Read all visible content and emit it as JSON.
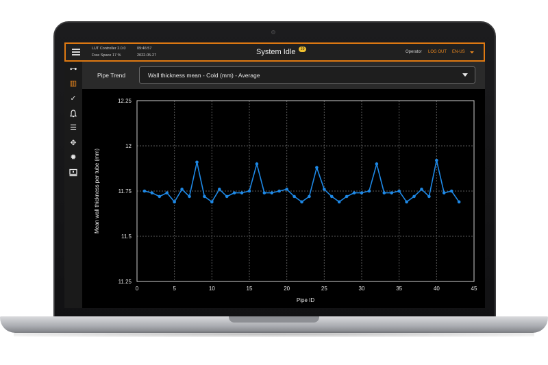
{
  "header": {
    "controller": "LUT Controller 2.0.0",
    "time": "09:46:57",
    "free_space": "Free Space 17 %",
    "date": "2022-05-27",
    "title": "System Idle",
    "badge": "19",
    "role": "Operator",
    "logout": "LOG OUT",
    "language": "EN-US"
  },
  "sidebar": {
    "items": [
      {
        "icon": "network-icon",
        "glyph": "⊶"
      },
      {
        "icon": "chart-icon",
        "glyph": "▥",
        "active": true
      },
      {
        "icon": "check-circle-icon",
        "glyph": "✓"
      },
      {
        "icon": "bell-icon",
        "glyph": "♫"
      },
      {
        "icon": "list-icon",
        "glyph": "☰"
      },
      {
        "icon": "move-icon",
        "glyph": "✥"
      },
      {
        "icon": "gear-icon",
        "glyph": "✹"
      },
      {
        "icon": "monitor-icon",
        "glyph": "▣"
      }
    ]
  },
  "trend": {
    "label": "Pipe Trend",
    "selected": "Wall thickness mean - Cold (mm) - Average"
  },
  "colors": {
    "accent": "#f08a1e",
    "series": "#1e88e5",
    "grid": "#5a5a5a"
  },
  "chart_data": {
    "type": "line",
    "xlabel": "Pipe ID",
    "ylabel": "Mean wall thickness per tube (mm)",
    "xlim": [
      0,
      45
    ],
    "ylim": [
      11.25,
      12.25
    ],
    "xticks": [
      0,
      5,
      10,
      15,
      20,
      25,
      30,
      35,
      40,
      45
    ],
    "yticks": [
      11.25,
      11.5,
      11.75,
      12,
      12.25
    ],
    "ytick_labels": [
      "11.25",
      "11.5",
      "11.75",
      "12",
      "12.25"
    ],
    "grid": true,
    "series": [
      {
        "x": [
          1,
          2,
          3,
          4,
          5,
          6,
          7,
          8,
          9,
          10,
          11,
          12,
          13,
          14,
          15,
          16,
          17,
          18,
          19,
          20,
          21,
          22,
          23,
          24,
          25,
          26,
          27,
          28,
          29,
          30,
          31,
          32,
          33,
          34,
          35,
          36,
          37,
          38,
          39,
          40,
          41,
          42,
          43
        ],
        "values": [
          11.75,
          11.74,
          11.72,
          11.74,
          11.69,
          11.76,
          11.72,
          11.91,
          11.72,
          11.69,
          11.76,
          11.72,
          11.74,
          11.74,
          11.75,
          11.9,
          11.74,
          11.74,
          11.75,
          11.76,
          11.72,
          11.69,
          11.72,
          11.88,
          11.76,
          11.72,
          11.69,
          11.72,
          11.74,
          11.74,
          11.75,
          11.9,
          11.74,
          11.74,
          11.75,
          11.69,
          11.72,
          11.76,
          11.72,
          11.92,
          11.74,
          11.75,
          11.69
        ]
      }
    ]
  }
}
